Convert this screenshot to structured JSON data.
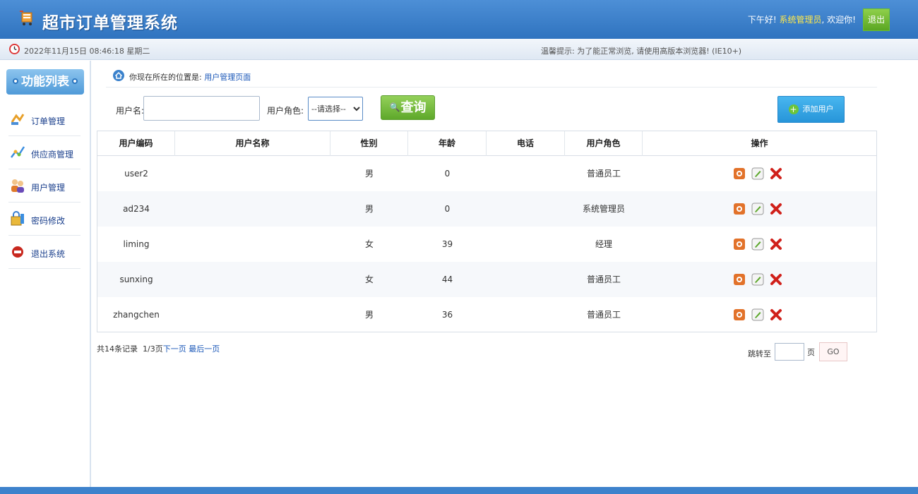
{
  "header": {
    "title": "超市订单管理系统",
    "greeting": "下午好!",
    "user": "系统管理员",
    "welcome": ", 欢迎你!",
    "logout": "退出"
  },
  "infobar": {
    "datetime": "2022年11月15日 08:46:18 星期二",
    "tip": "温馨提示: 为了能正常浏览, 请使用高版本浏览器! (IE10+)"
  },
  "sidebar": {
    "heading": "功能列表",
    "items": [
      {
        "label": "订单管理",
        "icon": "order-icon"
      },
      {
        "label": "供应商管理",
        "icon": "supplier-icon"
      },
      {
        "label": "用户管理",
        "icon": "users-icon"
      },
      {
        "label": "密码修改",
        "icon": "password-icon"
      },
      {
        "label": "退出系统",
        "icon": "exit-icon"
      }
    ]
  },
  "breadcrumb": {
    "prefix": "你现在所在的位置是:",
    "current": "用户管理页面"
  },
  "search": {
    "username_label": "用户名:",
    "username_value": "",
    "role_label": "用户角色:",
    "role_selected": "--请选择--",
    "search_label": "查询",
    "add_label": "添加用户"
  },
  "table": {
    "headers": [
      "用户编码",
      "用户名称",
      "性别",
      "年龄",
      "电话",
      "用户角色",
      "操作"
    ],
    "rows": [
      {
        "code": "user2",
        "name": "",
        "gender": "男",
        "age": "0",
        "phone": "",
        "role": "普通员工"
      },
      {
        "code": "ad234",
        "name": "",
        "gender": "男",
        "age": "0",
        "phone": "",
        "role": "系统管理员"
      },
      {
        "code": "liming",
        "name": "",
        "gender": "女",
        "age": "39",
        "phone": "",
        "role": "经理"
      },
      {
        "code": "sunxing",
        "name": "",
        "gender": "女",
        "age": "44",
        "phone": "",
        "role": "普通员工"
      },
      {
        "code": "zhangchen",
        "name": "",
        "gender": "男",
        "age": "36",
        "phone": "",
        "role": "普通员工"
      }
    ]
  },
  "paging": {
    "total": "共14条记录",
    "pages": "1/3页",
    "next": "下一页",
    "last": "最后一页",
    "jump_label": "跳转至",
    "page_unit": "页",
    "go": "GO"
  },
  "colors": {
    "header": "#2f73bf",
    "accent_green": "#5ea82a",
    "link": "#1a57b8",
    "user_yellow": "#ffe84a"
  }
}
